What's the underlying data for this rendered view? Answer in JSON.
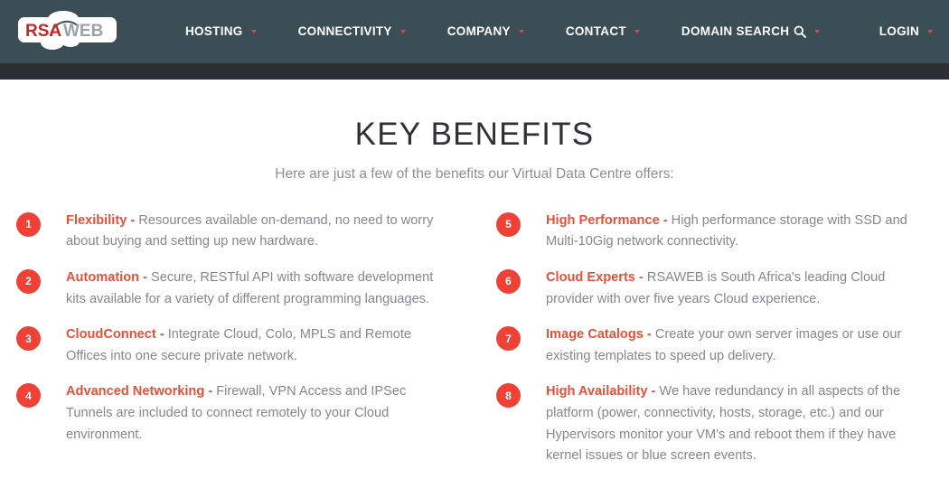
{
  "header": {
    "logo": {
      "name": "rsaweb-logo",
      "text_red": "RSA",
      "text_gray": "WEB",
      "color_red": "#cc2229",
      "color_gray": "#9aa3a8",
      "background": "#ffffff"
    },
    "background_color": "#3b4d55",
    "sub_band_color": "#2a2e33",
    "caret_color": "#e8433c",
    "nav_items": [
      {
        "label": "HOSTING",
        "has_caret": true,
        "icon": null
      },
      {
        "label": "CONNECTIVITY",
        "has_caret": true,
        "icon": null
      },
      {
        "label": "COMPANY",
        "has_caret": true,
        "icon": null
      },
      {
        "label": "CONTACT",
        "has_caret": true,
        "icon": null
      },
      {
        "label": "DOMAIN SEARCH",
        "has_caret": true,
        "icon": "search-icon"
      }
    ],
    "login": {
      "label": "LOGIN",
      "has_caret": true
    }
  },
  "main": {
    "title": "KEY BENEFITS",
    "subtitle": "Here are just a few of the benefits our Virtual Data Centre offers:",
    "badge_color": "#ef4136",
    "title_accent_color": "#e8503a",
    "body_text_color": "#84878c",
    "benefits_left": [
      {
        "number": "1",
        "title": "Flexibility -",
        "text": " Resources available on-demand, no need to worry about buying and setting up new hardware."
      },
      {
        "number": "2",
        "title": "Automation -",
        "text": " Secure, RESTful API with software development kits available for a variety of different programming languages."
      },
      {
        "number": "3",
        "title": "CloudConnect -",
        "text": " Integrate Cloud, Colo, MPLS and Remote Offices into one secure private network."
      },
      {
        "number": "4",
        "title": "Advanced Networking -",
        "text": " Firewall, VPN Access and IPSec Tunnels are included to connect remotely to your Cloud environment."
      }
    ],
    "benefits_right": [
      {
        "number": "5",
        "title": "High Performance -",
        "text": " High performance storage with SSD and Multi-10Gig network connectivity."
      },
      {
        "number": "6",
        "title": "Cloud Experts -",
        "text": " RSAWEB is South Africa's leading Cloud provider with over five years Cloud experience."
      },
      {
        "number": "7",
        "title": "Image Catalogs -",
        "text": " Create your own server images or use our existing templates to speed up delivery."
      },
      {
        "number": "8",
        "title": "High Availability -",
        "text": " We have redundancy in all aspects of the platform (power, connectivity, hosts, storage, etc.) and our Hypervisors monitor your VM's and reboot them if they have kernel issues or blue screen events."
      }
    ]
  }
}
